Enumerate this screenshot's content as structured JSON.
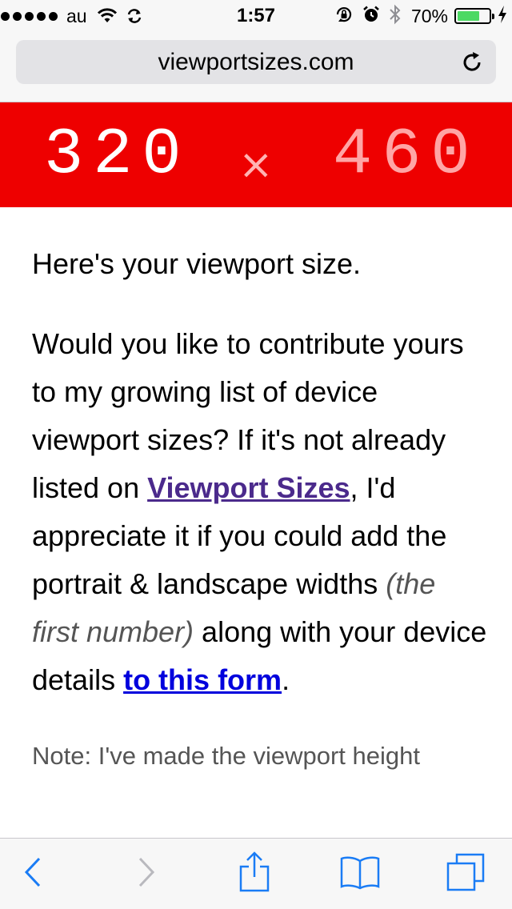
{
  "status_bar": {
    "carrier": "au",
    "time": "1:57",
    "battery_percent": "70%",
    "battery_level": 0.7,
    "icons": [
      "signal-dots-icon",
      "wifi-icon",
      "sync-icon",
      "rotation-lock-icon",
      "alarm-icon",
      "bluetooth-icon",
      "battery-icon",
      "charging-icon"
    ]
  },
  "address_bar": {
    "url": "viewportsizes.com",
    "reload_icon": "reload-icon"
  },
  "banner": {
    "width": "320",
    "separator": "×",
    "height": "460",
    "color": "#ee0000"
  },
  "content": {
    "intro": "Here's your viewport size.",
    "paragraph": {
      "part1": "Would you like to contribute yours to my growing list of device viewport sizes? If it's not already listed on ",
      "link1": "Viewport Sizes",
      "part2": ", I'd appreciate it if you could add the portrait & landscape widths ",
      "italic": "(the first number)",
      "part3": " along with your device details ",
      "link2": "to this form",
      "part4": "."
    },
    "note": "Note: I've made the viewport height"
  },
  "toolbar": {
    "icons": [
      "back-icon",
      "forward-icon",
      "share-icon",
      "bookmarks-icon",
      "tabs-icon"
    ],
    "accent": "#1a7cf5"
  }
}
